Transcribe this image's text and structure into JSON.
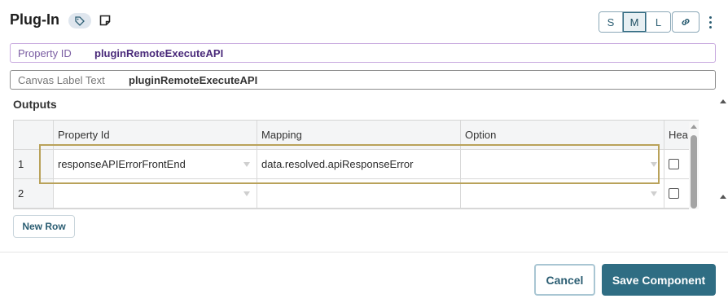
{
  "header": {
    "title": "Plug-In",
    "sizes": [
      "S",
      "M",
      "L"
    ],
    "active_size": "M"
  },
  "fields": {
    "property_id": {
      "label": "Property ID",
      "value": "pluginRemoteExecuteAPI"
    },
    "canvas_label": {
      "label": "Canvas Label Text",
      "value": "pluginRemoteExecuteAPI"
    }
  },
  "outputs": {
    "title": "Outputs",
    "columns": [
      "Property Id",
      "Mapping",
      "Option",
      "Hea"
    ],
    "rows": [
      {
        "num": "1",
        "property_id": "responseAPIErrorFrontEnd",
        "mapping": "data.resolved.apiResponseError",
        "option": "",
        "checked": false
      },
      {
        "num": "2",
        "property_id": "",
        "mapping": "",
        "option": "",
        "checked": false
      }
    ],
    "new_row_label": "New Row"
  },
  "footer": {
    "cancel_label": "Cancel",
    "save_label": "Save Component"
  },
  "colors": {
    "accent": "#2f6d83",
    "selected_row_outline": "#b9a25a",
    "property_field_border": "#c7a8de"
  }
}
